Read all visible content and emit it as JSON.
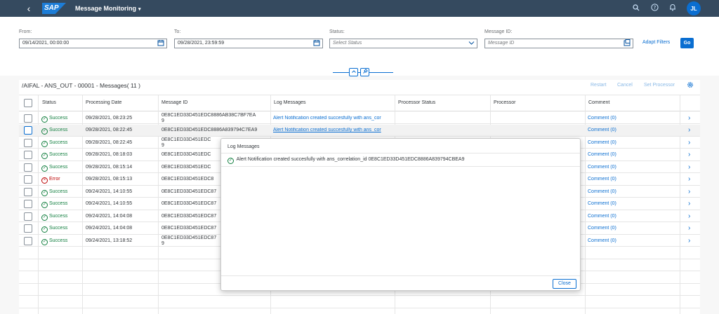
{
  "shell": {
    "back_glyph": "‹",
    "logo": "SAP",
    "title": "Message Monitoring",
    "title_caret": "▾",
    "avatar": "JL"
  },
  "filters": {
    "from_label": "From:",
    "from_value": "09/14/2021, 00:00:00",
    "to_label": "To:",
    "to_value": "09/28/2021, 23:59:59",
    "status_label": "Status:",
    "status_placeholder": "Select Status",
    "msgid_label": "Message ID:",
    "msgid_placeholder": "Message ID",
    "adapt_filters": "Adapt Filters",
    "go": "Go"
  },
  "table": {
    "title": "/AIFAL - ANS_OUT - 00001 - Messages( 11 )",
    "actions": {
      "restart": "Restart",
      "cancel": "Cancel",
      "set_processor": "Set Processor"
    },
    "columns": [
      "Status",
      "Processing Date",
      "Message ID",
      "Log Messages",
      "Processor Status",
      "Processor",
      "Comment"
    ],
    "rows": [
      {
        "status": "Success",
        "date": "09/28/2021, 08:23:25",
        "id1": "0E8C1ED33D451EDC8886AB38C7BF7EA",
        "id2": "9",
        "log": "Alert Notification created succesfully with ans_cor",
        "comment": "Comment (0)"
      },
      {
        "status": "Success",
        "date": "09/28/2021, 08:22:45",
        "id1": "0E8C1ED33D451EDC8886A839794C7EA9",
        "id2": "",
        "log": "Alert Notification created succesfully with ans_cor",
        "comment": "Comment (0)"
      },
      {
        "status": "Success",
        "date": "09/28/2021, 08:22:45",
        "id1": "0E8C1ED33D451EDC",
        "id2": "9",
        "log": "",
        "comment": "Comment (0)"
      },
      {
        "status": "Success",
        "date": "09/28/2021, 08:18:03",
        "id1": "0E8C1ED33D451EDC",
        "id2": "",
        "log": "",
        "comment": "Comment (0)"
      },
      {
        "status": "Success",
        "date": "09/28/2021, 08:15:14",
        "id1": "0E8C1ED33D451EDC",
        "id2": "",
        "log": "",
        "comment": "Comment (0)"
      },
      {
        "status": "Error",
        "date": "09/28/2021, 08:15:13",
        "id1": "0E8C1ED33D451EDC8",
        "id2": "",
        "log": "",
        "comment": "Comment (0)"
      },
      {
        "status": "Success",
        "date": "09/24/2021, 14:10:55",
        "id1": "0E8C1ED33D451EDC87",
        "id2": "",
        "log": "",
        "comment": "Comment (0)"
      },
      {
        "status": "Success",
        "date": "09/24/2021, 14:10:55",
        "id1": "0E8C1ED33D451EDC87",
        "id2": "",
        "log": "",
        "comment": "Comment (0)"
      },
      {
        "status": "Success",
        "date": "09/24/2021, 14:04:08",
        "id1": "0E8C1ED33D451EDC87",
        "id2": "",
        "log": "",
        "comment": "Comment (0)"
      },
      {
        "status": "Success",
        "date": "09/24/2021, 14:04:08",
        "id1": "0E8C1ED33D451EDC87",
        "id2": "",
        "log": "",
        "comment": "Comment (0)"
      },
      {
        "status": "Success",
        "date": "09/24/2021, 13:18:52",
        "id1": "0E8C1ED33D451EDC87",
        "id2": "9",
        "log": "",
        "comment": "Comment (0)"
      }
    ]
  },
  "popover": {
    "title": "Log Messages",
    "message": "Alert Notification created succesfully with ans_correlation_id 0E8C1ED33D451EDC8886A839794CBEA9",
    "close": "Close"
  },
  "colors": {
    "shell": "#354a5f",
    "brand": "#0a6ed1",
    "success": "#107e3e",
    "error": "#bb0000"
  },
  "icons": {
    "search": "search-icon",
    "help": "help-icon",
    "bell": "notification-icon",
    "calendar": "calendar-icon",
    "dropdown": "chevron-down-icon",
    "value_help": "value-help-icon",
    "settings": "gear-icon",
    "nav": "chevron-right-icon"
  }
}
